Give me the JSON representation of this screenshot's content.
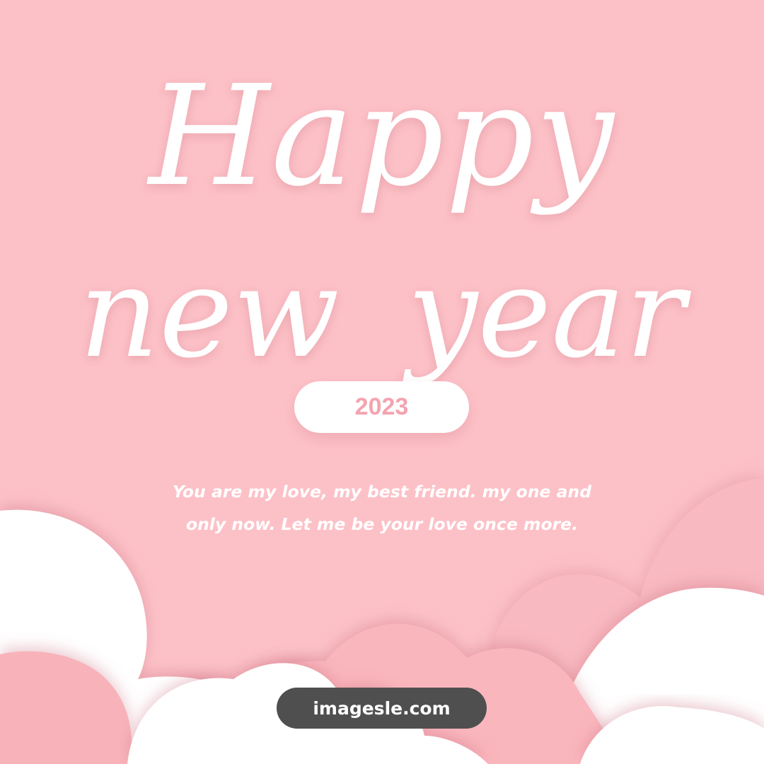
{
  "greeting": {
    "line1": "Happy",
    "line2": "new year"
  },
  "year_badge": "2023",
  "message": {
    "line1": "You are my love, my best friend. my one and",
    "line2": "only now. Let me be your love once more."
  },
  "watermark": "imagesle.com",
  "colors": {
    "background": "#fcc1c7",
    "cloud_white": "#ffffff",
    "cloud_pink": "#f8b6bd",
    "year_text": "#f4a3b0",
    "watermark_bg": "#4f4f4f"
  }
}
